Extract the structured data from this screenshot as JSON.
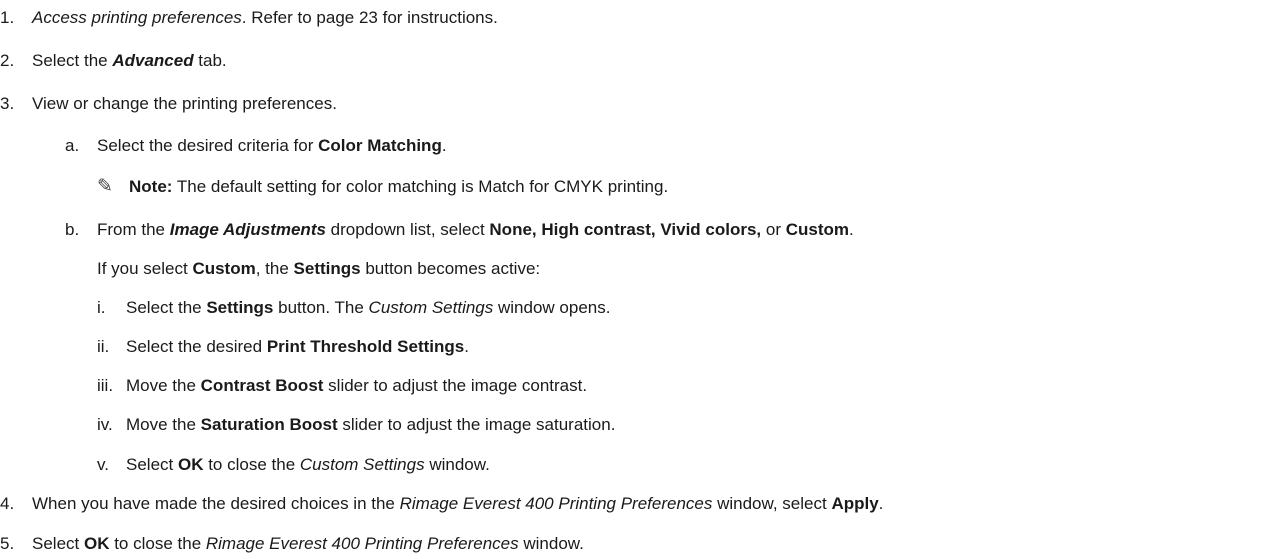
{
  "steps": [
    {
      "num": "1.",
      "parts": [
        {
          "t": "Access printing preferences",
          "s": "i"
        },
        {
          "t": ". Refer to page 23 for instructions.",
          "s": ""
        }
      ]
    },
    {
      "num": "2.",
      "parts": [
        {
          "t": "Select the ",
          "s": ""
        },
        {
          "t": "Advanced",
          "s": "bi"
        },
        {
          "t": " tab.",
          "s": ""
        }
      ]
    },
    {
      "num": "3.",
      "parts": [
        {
          "t": "View or change the printing preferences.",
          "s": ""
        }
      ]
    },
    {
      "num": "a.",
      "parts": [
        {
          "t": "Select the desired criteria for ",
          "s": ""
        },
        {
          "t": "Color Matching",
          "s": "b"
        },
        {
          "t": ".",
          "s": ""
        }
      ]
    },
    {
      "num": "",
      "note": true,
      "parts": [
        {
          "t": "Note:",
          "s": "b"
        },
        {
          "t": " The default setting for color matching is Match for CMYK printing.",
          "s": ""
        }
      ]
    },
    {
      "num": "b.",
      "parts": [
        {
          "t": "From the ",
          "s": ""
        },
        {
          "t": "Image Adjustments",
          "s": "bi"
        },
        {
          "t": " dropdown list, select ",
          "s": ""
        },
        {
          "t": "None, High contrast, Vivid colors,",
          "s": "b"
        },
        {
          "t": " or ",
          "s": ""
        },
        {
          "t": "Custom",
          "s": "b"
        },
        {
          "t": ".",
          "s": ""
        }
      ]
    },
    {
      "num": "",
      "parts": [
        {
          "t": "If you select ",
          "s": ""
        },
        {
          "t": "Custom",
          "s": "b"
        },
        {
          "t": ", the ",
          "s": ""
        },
        {
          "t": "Settings",
          "s": "b"
        },
        {
          "t": " button becomes active:",
          "s": ""
        }
      ]
    },
    {
      "num": "i.",
      "parts": [
        {
          "t": "Select the ",
          "s": ""
        },
        {
          "t": "Settings",
          "s": "b"
        },
        {
          "t": " button. The ",
          "s": ""
        },
        {
          "t": "Custom Settings",
          "s": "i"
        },
        {
          "t": " window opens.",
          "s": ""
        }
      ]
    },
    {
      "num": "ii.",
      "parts": [
        {
          "t": "Select the desired ",
          "s": ""
        },
        {
          "t": "Print Threshold Settings",
          "s": "b"
        },
        {
          "t": ".",
          "s": ""
        }
      ]
    },
    {
      "num": "iii.",
      "parts": [
        {
          "t": "Move the ",
          "s": ""
        },
        {
          "t": "Contrast Boost",
          "s": "b"
        },
        {
          "t": " slider to adjust the image contrast.",
          "s": ""
        }
      ]
    },
    {
      "num": "iv.",
      "parts": [
        {
          "t": "Move the ",
          "s": ""
        },
        {
          "t": "Saturation Boost",
          "s": "b"
        },
        {
          "t": " slider to adjust the image saturation.",
          "s": ""
        }
      ]
    },
    {
      "num": "v.",
      "parts": [
        {
          "t": "Select ",
          "s": ""
        },
        {
          "t": "OK",
          "s": "b"
        },
        {
          "t": " to close the ",
          "s": ""
        },
        {
          "t": "Custom Settings",
          "s": "i"
        },
        {
          "t": " window.",
          "s": ""
        }
      ]
    },
    {
      "num": "4.",
      "parts": [
        {
          "t": "When you have made the desired choices in the ",
          "s": ""
        },
        {
          "t": "Rimage Everest 400 Printing Preferences",
          "s": "i"
        },
        {
          "t": " window, select ",
          "s": ""
        },
        {
          "t": "Apply",
          "s": "b"
        },
        {
          "t": ".",
          "s": ""
        }
      ]
    },
    {
      "num": "5.",
      "parts": [
        {
          "t": "Select ",
          "s": ""
        },
        {
          "t": "OK",
          "s": "b"
        },
        {
          "t": " to close the ",
          "s": ""
        },
        {
          "t": "Rimage Everest 400 Printing Preferences",
          "s": "i"
        },
        {
          "t": " window.",
          "s": ""
        }
      ]
    }
  ],
  "note_icon": "pencil-note-icon",
  "note_glyph": "✎"
}
